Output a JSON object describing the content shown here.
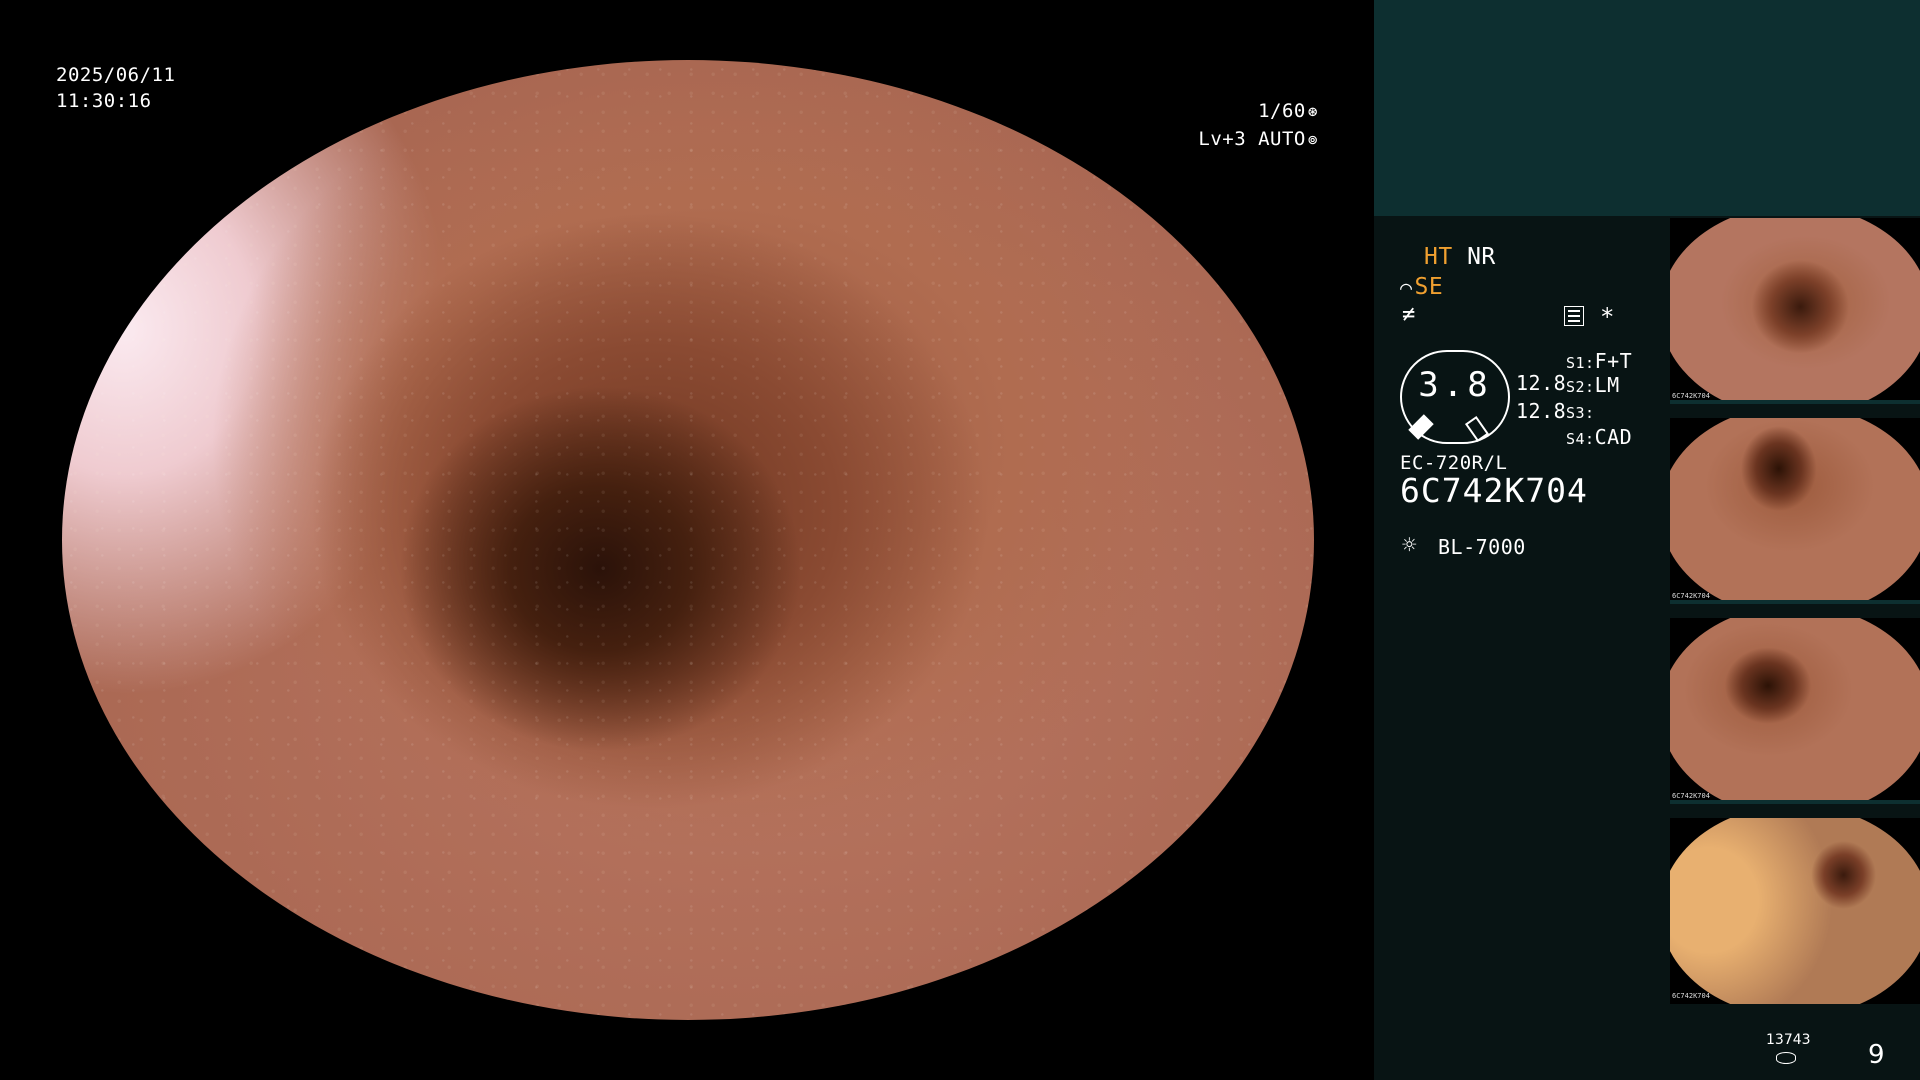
{
  "overlay": {
    "date": "2025/06/11",
    "time": "11:30:16",
    "shutter": "1/60",
    "shutter_icon": "aperture-icon",
    "level": "Lv+3",
    "mode": "AUTO",
    "mode_icon": "iris-icon"
  },
  "panel": {
    "ht": "HT",
    "nr": "NR",
    "se": "SE",
    "se_icon": "structure-icon",
    "enhance_icon": "enhancement-icon",
    "star": "*",
    "gauge_value": "3.8",
    "value_1": "12.8",
    "value_2": "12.8",
    "switches": [
      {
        "key": "S1:",
        "value": "F+T"
      },
      {
        "key": "S2:",
        "value": "LM"
      },
      {
        "key": "S3:",
        "value": ""
      },
      {
        "key": "S4:",
        "value": "CAD"
      }
    ],
    "scope_model": "EC-720R/L",
    "scope_serial": "6C742K704",
    "light_source": "BL-7000",
    "image_count": "13743",
    "page_number": "9"
  },
  "thumbnails": [
    {
      "caption": "6C742K704"
    },
    {
      "caption": "6C742K704"
    },
    {
      "caption": "6C742K704"
    },
    {
      "caption": "6C742K704"
    }
  ],
  "colors": {
    "panel_top": "#0d2f30",
    "panel_bottom": "#081414",
    "accent_orange": "#f0a030"
  }
}
